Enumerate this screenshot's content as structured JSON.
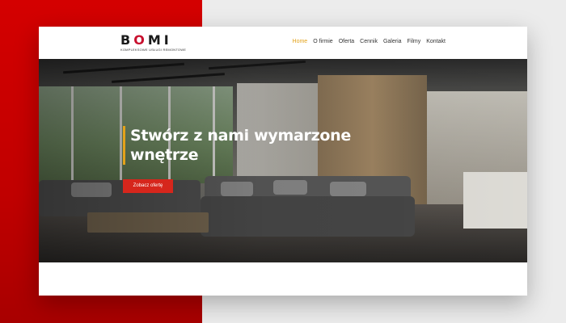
{
  "brand": {
    "name_start": "B",
    "name_accent": "O",
    "name_end": "MI",
    "tagline": "KOMPLEKSOWE USŁUGI REMONTOWE"
  },
  "nav": {
    "items": [
      {
        "label": "Home",
        "active": true
      },
      {
        "label": "O firmie",
        "active": false
      },
      {
        "label": "Oferta",
        "active": false
      },
      {
        "label": "Cennik",
        "active": false
      },
      {
        "label": "Galeria",
        "active": false
      },
      {
        "label": "Filmy",
        "active": false
      },
      {
        "label": "Kontakt",
        "active": false
      }
    ]
  },
  "hero": {
    "title_line1": "Stwórz z nami wymarzone",
    "title_line2": "wnętrze",
    "cta_label": "Zobacz ofertę"
  },
  "colors": {
    "accent": "#e3a21a",
    "cta": "#d6261c",
    "brand_red": "#c8102e",
    "background_panel": "#c00000"
  },
  "icons": {
    "hero_image": "living-room-photo"
  }
}
